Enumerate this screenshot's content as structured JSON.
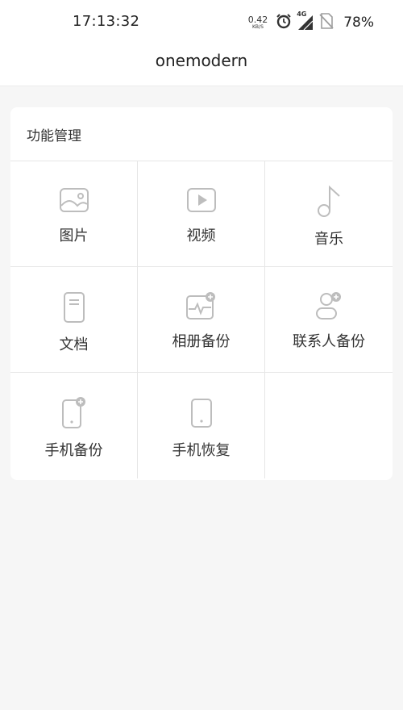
{
  "status_bar": {
    "time": "17:13:32",
    "net_speed_value": "0.42",
    "net_speed_unit": "KB/S",
    "network_type": "4G",
    "battery_percent": "78%",
    "icons": [
      "alarm-icon",
      "signal-icon",
      "no-sim-icon"
    ]
  },
  "app_bar": {
    "title": "onemodern"
  },
  "function_panel": {
    "title": "功能管理",
    "items": [
      {
        "label": "图片",
        "icon": "image-icon"
      },
      {
        "label": "视频",
        "icon": "video-icon"
      },
      {
        "label": "音乐",
        "icon": "music-icon"
      },
      {
        "label": "文档",
        "icon": "document-icon"
      },
      {
        "label": "相册备份",
        "icon": "album-backup-icon"
      },
      {
        "label": "联系人备份",
        "icon": "contacts-backup-icon"
      },
      {
        "label": "手机备份",
        "icon": "phone-backup-icon"
      },
      {
        "label": "手机恢复",
        "icon": "phone-restore-icon"
      }
    ]
  },
  "colors": {
    "icon_stroke": "#bdbdbd",
    "background": "#f6f6f6",
    "card": "#ffffff",
    "divider": "#e6e6e6"
  }
}
